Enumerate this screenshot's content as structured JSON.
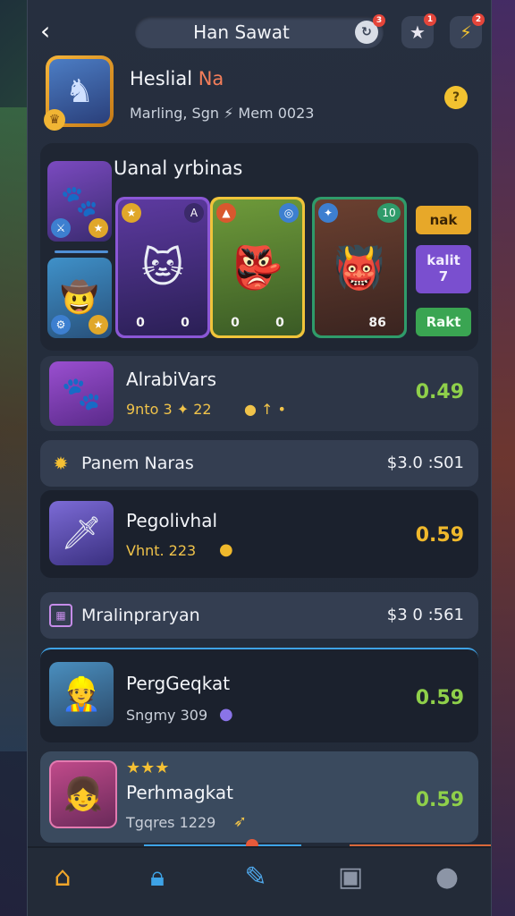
{
  "header": {
    "back_icon": "back-chevron-icon",
    "title": "Han Sawat",
    "title_icon": "refresh-icon",
    "title_badge": "3",
    "btn1_badge": "1",
    "btn2_badge": "2"
  },
  "profile": {
    "name_main": "Heslial ",
    "name_highlight": "Na",
    "subtitle": "Marling, Sgn ⚡ Mem 0023"
  },
  "showcase": {
    "title": "Uanal yrbinas",
    "cards": [
      {
        "stat_left": "0",
        "stat_right": "0"
      },
      {
        "stat_left": "0",
        "stat_right": "0"
      },
      {
        "stat_left": "",
        "stat_right": "86"
      }
    ],
    "card3_badge": "10",
    "actions": [
      "nak",
      "kalit\n7",
      "Rakt"
    ]
  },
  "rows": [
    {
      "title": "AlrabiVars",
      "sub": "9nto 3 ✦ 22",
      "price": "0.49",
      "price_color": "#8fd04a"
    },
    {
      "title": "Pegolivhal",
      "sub": "Vhnt. 223",
      "price": "0.59",
      "price_color": "#f0b92c"
    },
    {
      "title": "PergGeqkat",
      "sub": "Sngmy 309",
      "price": "0.59",
      "price_color": "#8fd04a"
    },
    {
      "title": "Perhmagkat",
      "sub": "Tgqres 1229",
      "price": "0.59",
      "price_color": "#8fd04a"
    }
  ],
  "sections": [
    {
      "label": "Panem Naras",
      "value": "$3.0 :S01"
    },
    {
      "label": "Mralinpraryan",
      "value": "$3 0 :561"
    }
  ],
  "last_row_stars": "★★★",
  "nav": [
    "home-icon",
    "lock-icon",
    "feather-icon",
    "inbox-icon",
    "profile-icon"
  ]
}
